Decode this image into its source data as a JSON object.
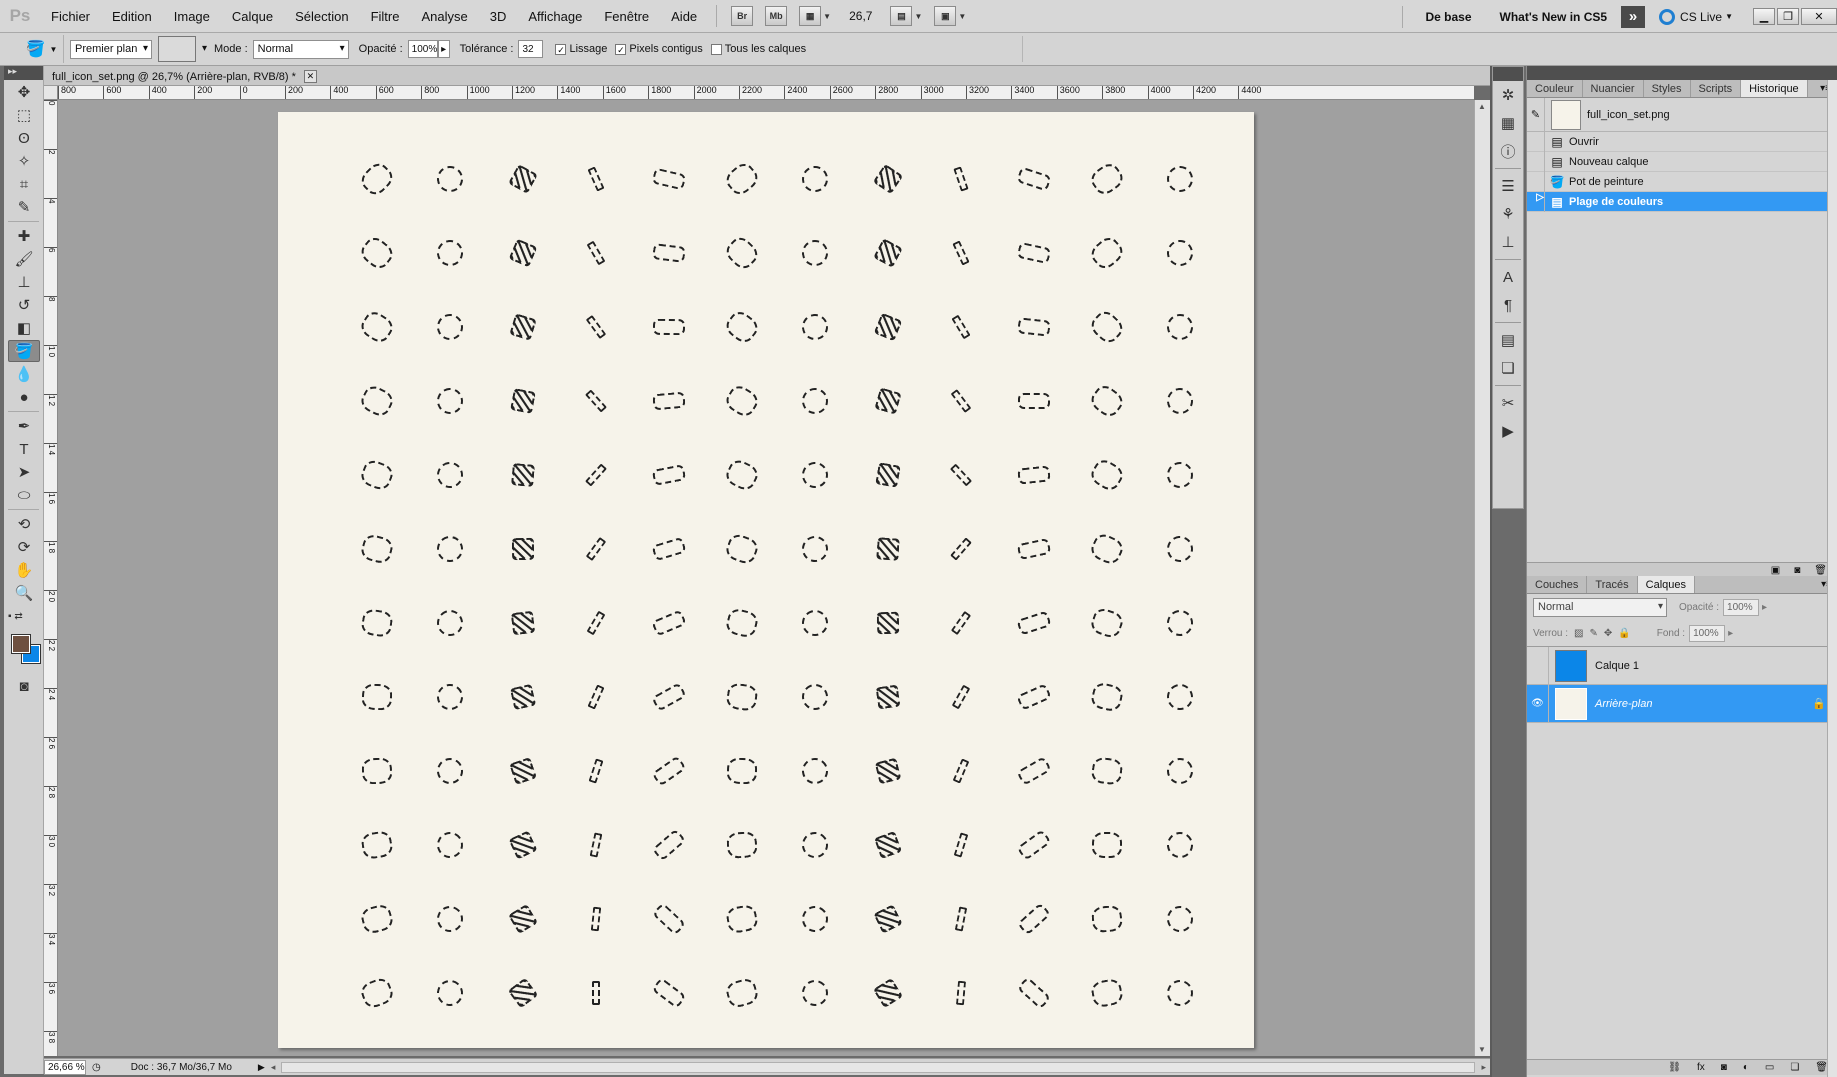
{
  "app": {
    "logo": "Ps"
  },
  "menu": [
    "Fichier",
    "Edition",
    "Image",
    "Calque",
    "Sélection",
    "Filtre",
    "Analyse",
    "3D",
    "Affichage",
    "Fenêtre",
    "Aide"
  ],
  "appbar": {
    "bridge": "Br",
    "minibridge": "Mb",
    "zoom": "26,7"
  },
  "workspace": {
    "base": "De base",
    "whats_new": "What's New in CS5",
    "more": "»",
    "cs_live": "CS Live"
  },
  "options": {
    "source": "Premier plan",
    "mode_label": "Mode :",
    "mode_value": "Normal",
    "opacity_label": "Opacité :",
    "opacity_value": "100%",
    "tolerance_label": "Tolérance :",
    "tolerance_value": "32",
    "antialias": "Lissage",
    "contiguous": "Pixels contigus",
    "all_layers": "Tous les calques"
  },
  "document": {
    "tab_title": "full_icon_set.png @ 26,7% (Arrière-plan, RVB/8) *",
    "ruler_top": [
      "800",
      "600",
      "400",
      "200",
      "0",
      "200",
      "400",
      "600",
      "800",
      "1000",
      "1200",
      "1400",
      "1600",
      "1800",
      "2000",
      "2200",
      "2400",
      "2600",
      "2800",
      "3000",
      "3200",
      "3400",
      "3600",
      "3800",
      "4000",
      "4200",
      "4400"
    ],
    "ruler_left": [
      "0",
      "2",
      "4",
      "6",
      "8",
      "1 0",
      "1 2",
      "1 4",
      "1 6",
      "1 8",
      "2 0",
      "2 2",
      "2 4",
      "2 6",
      "2 8",
      "3 0",
      "3 2",
      "3 4",
      "3 6",
      "3 8"
    ],
    "icon_grid": {
      "rows": 12,
      "cols": 12
    }
  },
  "status": {
    "zoom": "26,66 %",
    "doc": "Doc : 36,7 Mo/36,7 Mo"
  },
  "history_panel": {
    "tabs": [
      "Couleur",
      "Nuancier",
      "Styles",
      "Scripts",
      "Historique"
    ],
    "active_tab": "Historique",
    "snapshot": "full_icon_set.png",
    "items": [
      "Ouvrir",
      "Nouveau calque",
      "Pot de peinture",
      "Plage de couleurs"
    ],
    "active_item": "Plage de couleurs"
  },
  "layers_panel": {
    "tabs": [
      "Couches",
      "Tracés",
      "Calques"
    ],
    "active_tab": "Calques",
    "blend_mode": "Normal",
    "opacity_label": "Opacité :",
    "opacity_value": "100%",
    "lock_label": "Verrou :",
    "fill_label": "Fond :",
    "fill_value": "100%",
    "layers": [
      {
        "name": "Calque 1",
        "thumb_color": "#0b86e8",
        "visible": false
      },
      {
        "name": "Arrière-plan",
        "thumb_color": "#f6f3ea",
        "visible": true,
        "locked": true
      }
    ]
  },
  "colors": {
    "foreground": "#6e5040",
    "background": "#0b86e8",
    "selection": "#3399f3",
    "canvas": "#f6f3ea"
  }
}
